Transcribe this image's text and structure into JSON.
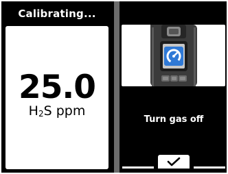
{
  "header": {
    "status": "Calibrating..."
  },
  "reading": {
    "value": "25.0",
    "gas_prefix": "H",
    "gas_subscript": "2",
    "gas_suffix": "S",
    "unit": "ppm"
  },
  "instruction": {
    "text": "Turn gas off"
  },
  "footer": {
    "confirm_icon": "checkmark-icon"
  },
  "device": {
    "screen_icon": "gauge-icon",
    "screen_color": "#2f79d6"
  }
}
